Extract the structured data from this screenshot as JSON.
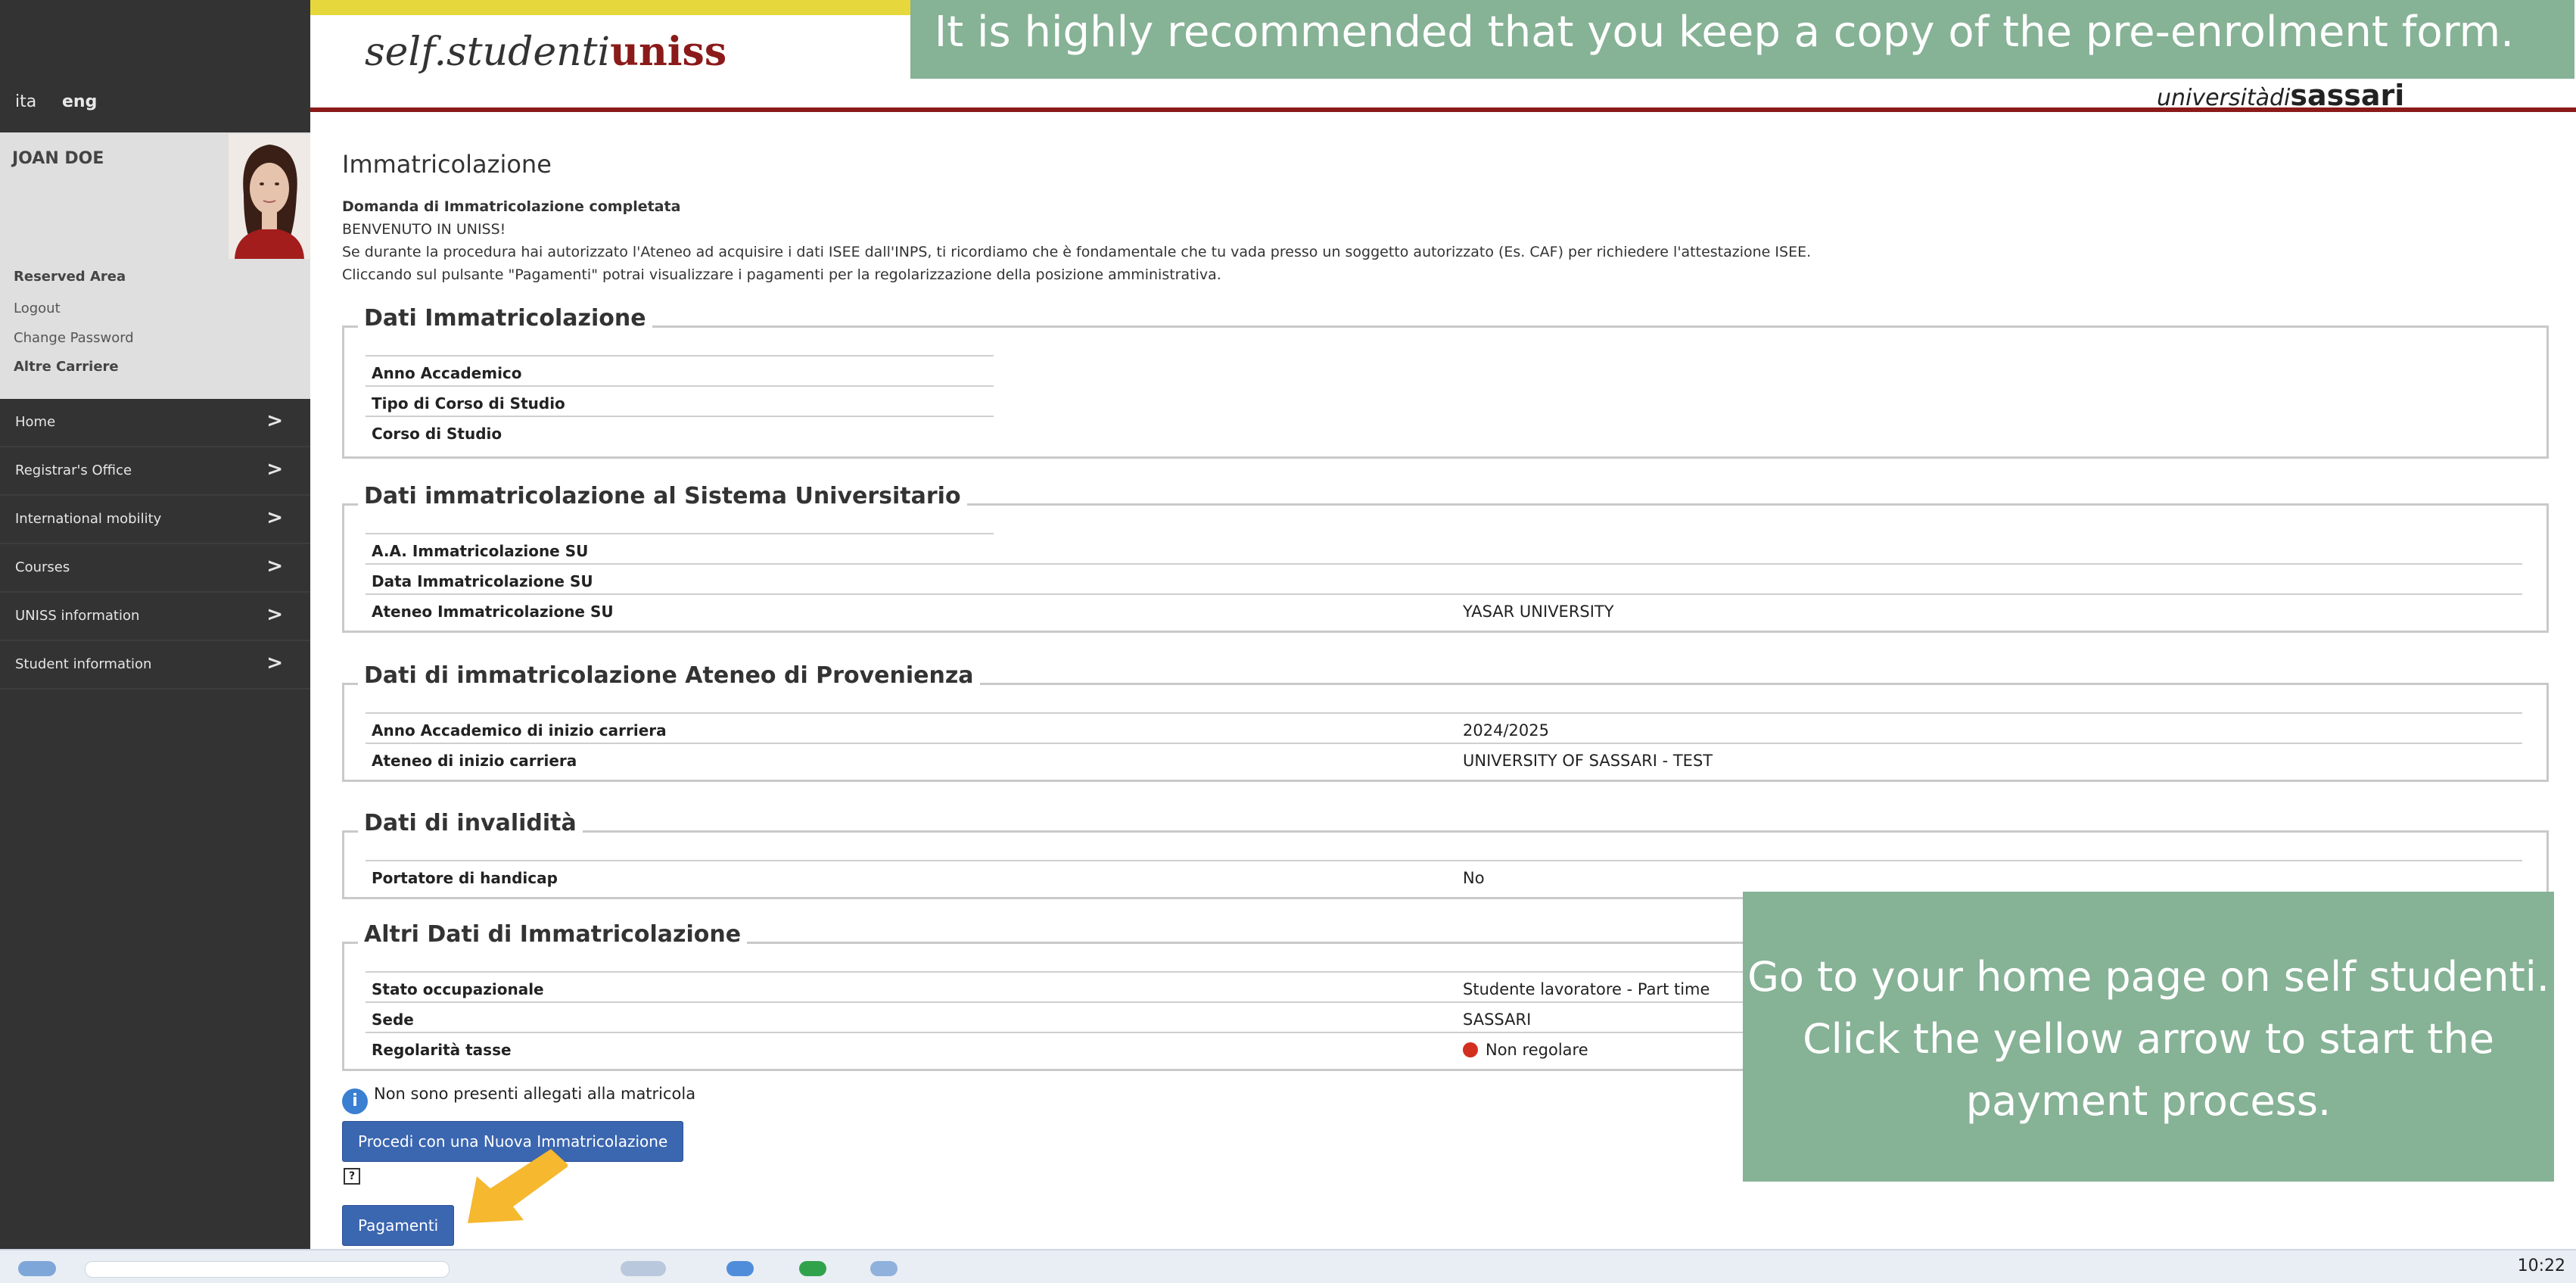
{
  "sidebar": {
    "lang_ita": "ita",
    "lang_eng": "eng",
    "user_name": "JOAN DOE",
    "links": [
      {
        "label": "Reserved Area"
      },
      {
        "label": "Logout"
      },
      {
        "label": "Change Password"
      },
      {
        "label": "Altre Carriere"
      }
    ],
    "nav": [
      {
        "label": "Home"
      },
      {
        "label": "Registrar's Office"
      },
      {
        "label": "International mobility"
      },
      {
        "label": "Courses"
      },
      {
        "label": "UNISS information"
      },
      {
        "label": "Student information"
      }
    ],
    "chevron": ">"
  },
  "header": {
    "brand_prefix": "self.studenti",
    "brand_accent": "uniss",
    "uni_logo_prefix": "universitàdi",
    "uni_logo_strong": "sassari"
  },
  "main": {
    "title": "Immatricolazione",
    "intro": [
      "Domanda di Immatricolazione completata",
      "BENVENUTO IN UNISS!",
      "Se durante la procedura hai autorizzato l'Ateneo ad acquisire i dati ISEE dall'INPS, ti ricordiamo che è fondamentale che tu vada presso un soggetto autorizzato (Es. CAF) per richiedere l'attestazione ISEE.",
      "Cliccando sul pulsante \"Pagamenti\" potrai visualizzare i pagamenti per la regolarizzazione della posizione amministrativa."
    ],
    "sections": [
      {
        "legend": "Dati Immatricolazione",
        "rows": [
          {
            "label": "Anno Accademico",
            "value": ""
          },
          {
            "label": "Tipo di Corso di Studio",
            "value": ""
          },
          {
            "label": "Corso di Studio",
            "value": ""
          }
        ]
      },
      {
        "legend": "Dati immatricolazione al Sistema Universitario",
        "rows": [
          {
            "label": "A.A. Immatricolazione SU",
            "value": ""
          },
          {
            "label": "Data Immatricolazione SU",
            "value": ""
          },
          {
            "label": "Ateneo Immatricolazione SU",
            "value": "YASAR UNIVERSITY"
          }
        ]
      },
      {
        "legend": "Dati di immatricolazione Ateneo di Provenienza",
        "rows": [
          {
            "label": "Anno Accademico di inizio carriera",
            "value": "2024/2025"
          },
          {
            "label": "Ateneo di inizio carriera",
            "value": "UNIVERSITY OF SASSARI - TEST"
          }
        ]
      },
      {
        "legend": "Dati di invalidità",
        "rows": [
          {
            "label": "Portatore di handicap",
            "value": "No"
          }
        ]
      },
      {
        "legend": "Altri Dati di Immatricolazione",
        "rows": [
          {
            "label": "Stato occupazionale",
            "value": "Studente lavoratore - Part time"
          },
          {
            "label": "Sede",
            "value": "SASSARI"
          },
          {
            "label": "Regolarità tasse",
            "value": "Non regolare"
          }
        ]
      }
    ],
    "info_icon": "i",
    "info_text": "Non sono presenti allegati alla matricola",
    "btn_new": "Procedi con una Nuova Immatricolazione",
    "help_icon": "?",
    "btn_pay": "Pagamenti"
  },
  "overlays": {
    "top_callout": "It is highly recommended that you keep a copy of the pre-enrolment form.",
    "right_callout": [
      "Go to your home page on self studenti.",
      "Click the yellow arrow to start the",
      "payment process."
    ]
  },
  "taskbar": {
    "time": "10:22"
  },
  "colors": {
    "sidebar": "#333333",
    "brand_red": "#8b1a1a",
    "button_blue": "#3b66b0",
    "callout_green": "#86b295",
    "arrow_yellow": "#f5b82e",
    "status_red": "#d32f1f"
  }
}
